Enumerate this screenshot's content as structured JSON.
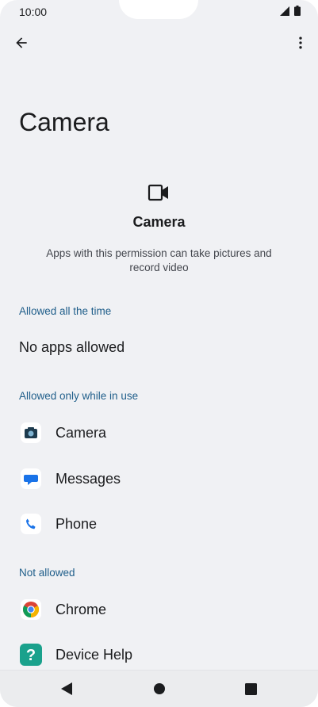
{
  "status_bar": {
    "time": "10:00"
  },
  "page": {
    "title": "Camera"
  },
  "header": {
    "icon": "videocam-icon",
    "label": "Camera",
    "description": "Apps with this permission can take pictures and record video"
  },
  "sections": {
    "allowed_always": {
      "title": "Allowed all the time",
      "empty_text": "No apps allowed"
    },
    "allowed_in_use": {
      "title": "Allowed only while in use",
      "apps": [
        {
          "label": "Camera",
          "icon": "camera-app-icon"
        },
        {
          "label": "Messages",
          "icon": "messages-app-icon"
        },
        {
          "label": "Phone",
          "icon": "phone-app-icon"
        }
      ]
    },
    "not_allowed": {
      "title": "Not allowed",
      "apps": [
        {
          "label": "Chrome",
          "icon": "chrome-app-icon"
        },
        {
          "label": "Device Help",
          "icon": "device-help-app-icon"
        }
      ]
    }
  },
  "colors": {
    "background": "#f0f1f4",
    "section_title": "#1f5e8a",
    "messages_blue": "#1a73e8",
    "device_help_teal": "#1aa18c"
  }
}
